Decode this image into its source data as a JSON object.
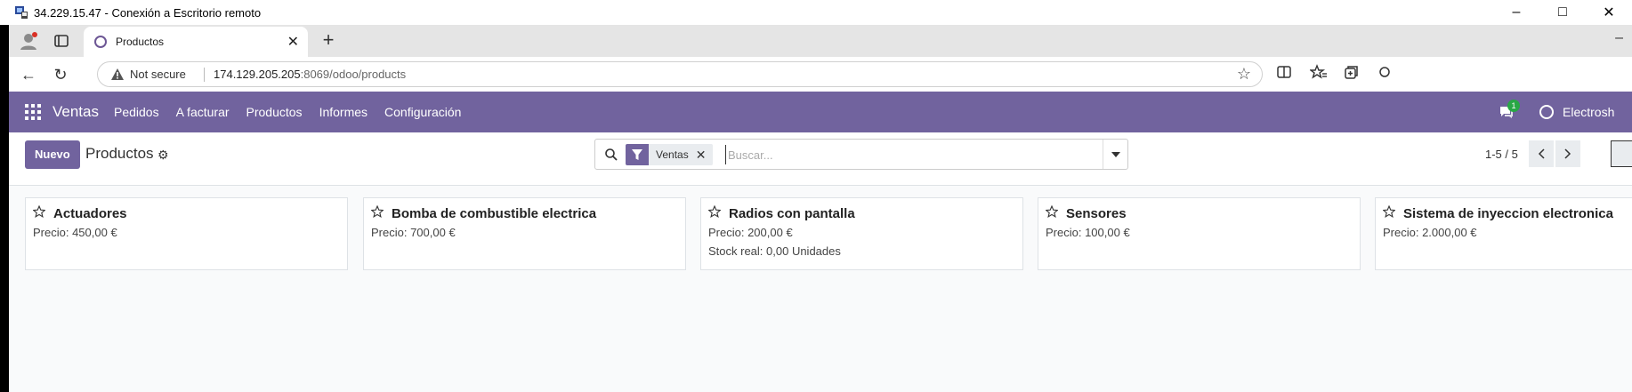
{
  "rdp": {
    "title": "34.229.15.47 - Conexión a Escritorio remoto"
  },
  "browser": {
    "tab": {
      "title": "Productos"
    },
    "address": {
      "security_label": "Not secure",
      "host": "174.129.205.205",
      "path": ":8069/odoo/products"
    }
  },
  "navbar": {
    "brand": "Ventas",
    "menu": [
      {
        "label": "Pedidos"
      },
      {
        "label": "A facturar"
      },
      {
        "label": "Productos"
      },
      {
        "label": "Informes"
      },
      {
        "label": "Configuración"
      }
    ],
    "messages_badge": "1",
    "company": "Electrosh"
  },
  "control_panel": {
    "new_label": "Nuevo",
    "breadcrumb": "Productos",
    "search": {
      "facet_value": "Ventas",
      "placeholder": "Buscar..."
    },
    "pager": "1-5 / 5"
  },
  "products": [
    {
      "name": "Actuadores",
      "price": "Precio: 450,00 €"
    },
    {
      "name": "Bomba de combustible electrica",
      "price": "Precio: 700,00 €"
    },
    {
      "name": "Radios con pantalla",
      "price": "Precio: 200,00 €",
      "stock": "Stock real: 0,00 Unidades"
    },
    {
      "name": "Sensores",
      "price": "Precio: 100,00 €"
    },
    {
      "name": "Sistema de inyeccion electronica",
      "price": "Precio: 2.000,00 €"
    }
  ],
  "colors": {
    "brand": "#71639e",
    "background": "#f9fafb"
  }
}
